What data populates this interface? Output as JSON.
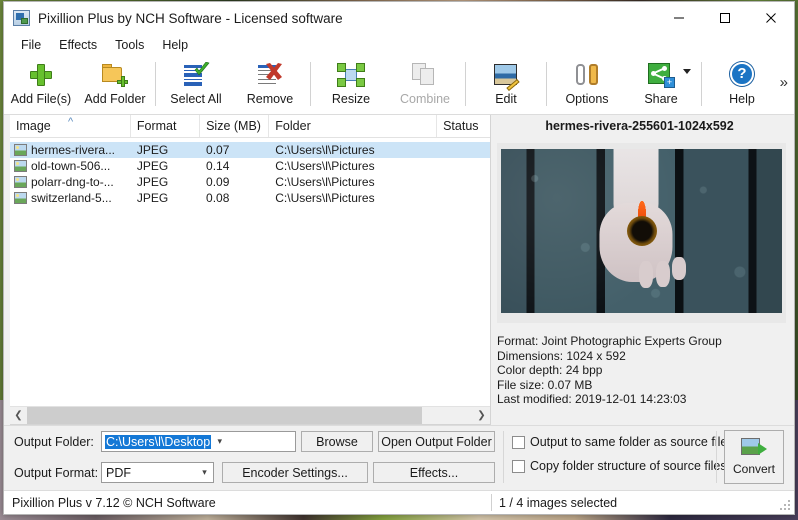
{
  "window": {
    "title": "Pixillion Plus by NCH Software - Licensed software",
    "icon": "app-icon",
    "controls": {
      "minimize": "minimize-icon",
      "maximize": "maximize-icon",
      "close": "close-icon"
    }
  },
  "menubar": {
    "items": [
      "File",
      "Effects",
      "Tools",
      "Help"
    ]
  },
  "toolbar": {
    "overflow_label": "»",
    "buttons": [
      {
        "label": "Add File(s)",
        "icon": "plus-icon",
        "disabled": false
      },
      {
        "label": "Add Folder",
        "icon": "folder-add-icon",
        "disabled": false
      },
      {
        "label": "Select All",
        "icon": "select-all-icon",
        "disabled": false
      },
      {
        "label": "Remove",
        "icon": "remove-icon",
        "disabled": false
      },
      {
        "label": "Resize",
        "icon": "resize-icon",
        "disabled": false
      },
      {
        "label": "Combine",
        "icon": "combine-icon",
        "disabled": true
      },
      {
        "label": "Edit",
        "icon": "edit-icon",
        "disabled": false
      },
      {
        "label": "Options",
        "icon": "options-icon",
        "disabled": false
      },
      {
        "label": "Share",
        "icon": "share-icon",
        "disabled": false
      },
      {
        "label": "Help",
        "icon": "help-icon",
        "disabled": false
      }
    ]
  },
  "file_list": {
    "columns": [
      "Image",
      "Format",
      "Size (MB)",
      "Folder",
      "Status"
    ],
    "sort_column": "Image",
    "sort_direction": "ascending",
    "rows": [
      {
        "image": "hermes-rivera...",
        "format": "JPEG",
        "size": "0.07",
        "folder": "C:\\Users\\l\\Pictures",
        "status": "",
        "selected": true
      },
      {
        "image": "old-town-506...",
        "format": "JPEG",
        "size": "0.14",
        "folder": "C:\\Users\\l\\Pictures",
        "status": "",
        "selected": false
      },
      {
        "image": "polarr-dng-to-...",
        "format": "JPEG",
        "size": "0.09",
        "folder": "C:\\Users\\l\\Pictures",
        "status": "",
        "selected": false
      },
      {
        "image": "switzerland-5...",
        "format": "JPEG",
        "size": "0.08",
        "folder": "C:\\Users\\l\\Pictures",
        "status": "",
        "selected": false
      }
    ]
  },
  "preview": {
    "title": "hermes-rivera-255601-1024x592",
    "image_alt": "hand-holding-orange-gerbera-flower",
    "info": {
      "format": "Format: Joint Photographic Experts Group",
      "dimensions": "Dimensions: 1024 x 592",
      "color_depth": "Color depth: 24 bpp",
      "file_size": "File size: 0.07 MB",
      "last_modified": "Last modified: 2019-12-01 14:23:03"
    }
  },
  "output": {
    "folder_label": "Output Folder:",
    "folder_value": "C:\\Users\\l\\Desktop",
    "folder_value_selected": true,
    "browse_label": "Browse",
    "open_output_label": "Open Output Folder",
    "format_label": "Output Format:",
    "format_value": "PDF",
    "encoder_label": "Encoder Settings...",
    "effects_label": "Effects...",
    "checkbox_same_folder": {
      "label": "Output to same folder as source files",
      "checked": false
    },
    "checkbox_copy_structure": {
      "label": "Copy folder structure of source files",
      "checked": false
    },
    "convert_label": "Convert",
    "convert_icon": "convert-icon"
  },
  "statusbar": {
    "left": "Pixillion Plus v 7.12 © NCH Software",
    "right": "1 / 4 images selected"
  },
  "colors": {
    "selection_blue": "#cce4f7",
    "text_select_blue": "#1478d6",
    "accent_green": "#67c02e",
    "window_bg": "#f0f0f0"
  }
}
